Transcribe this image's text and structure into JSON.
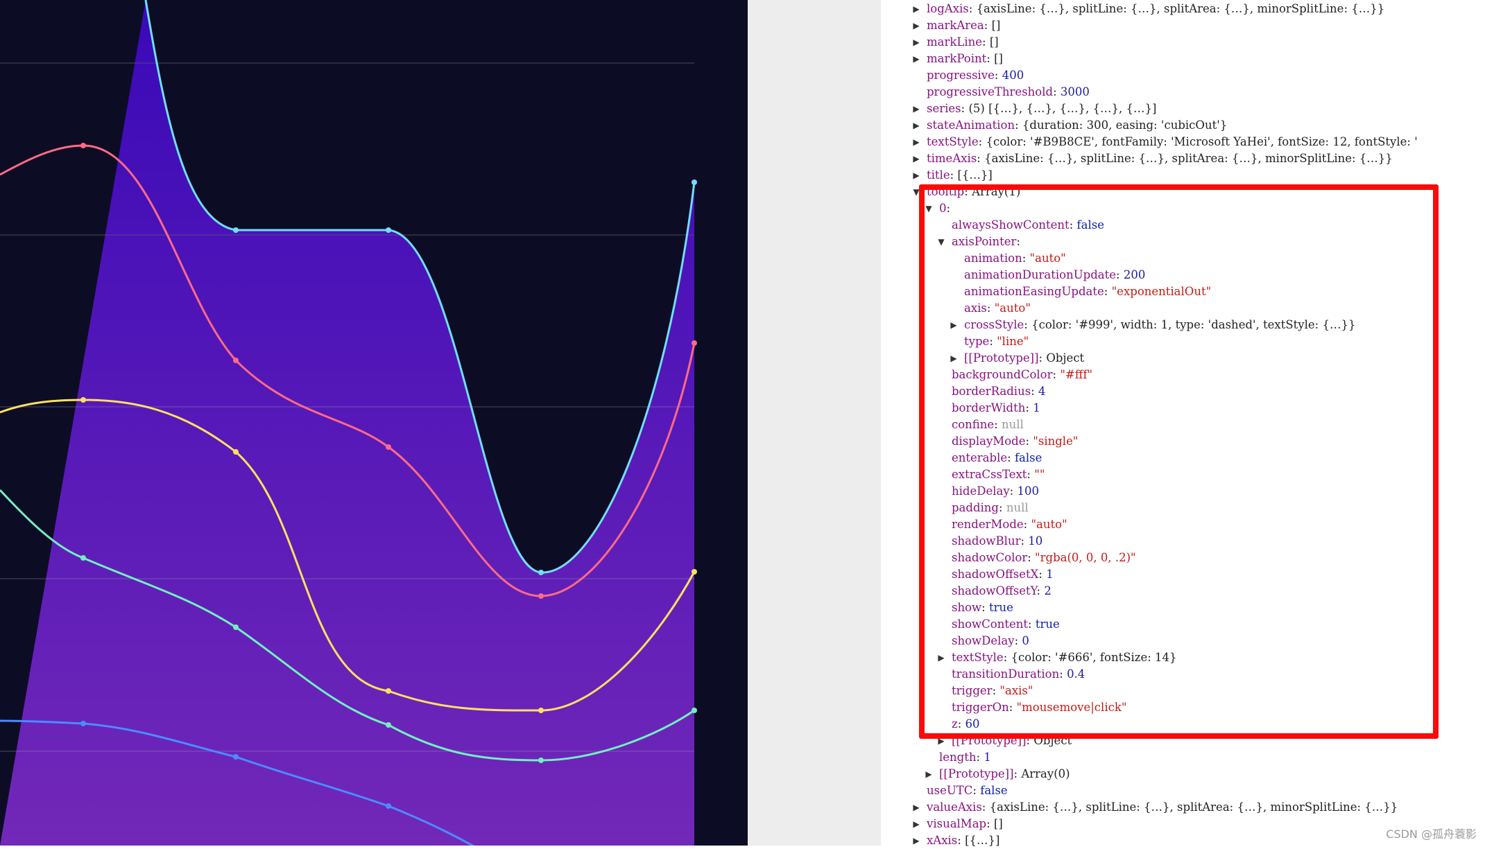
{
  "chart": {
    "background": "#0d0c25",
    "area_top": "#3a09b8",
    "area_bottom": "#7228b8",
    "series_colors": [
      "#6ee0ff",
      "#ff6b86",
      "#ffe15e",
      "#70f0c0",
      "#4a8cff"
    ]
  },
  "console": {
    "rows": [
      {
        "indent": 0,
        "tri": "right",
        "key": "logAxis",
        "value": "{axisLine: {…}, splitLine: {…}, splitArea: {…}, minorSplitLine: {…}}",
        "vtype": "obj"
      },
      {
        "indent": 0,
        "tri": "right",
        "key": "markArea",
        "value": "[]",
        "vtype": "obj"
      },
      {
        "indent": 0,
        "tri": "right",
        "key": "markLine",
        "value": "[]",
        "vtype": "obj"
      },
      {
        "indent": 0,
        "tri": "right",
        "key": "markPoint",
        "value": "[]",
        "vtype": "obj"
      },
      {
        "indent": 0,
        "tri": "",
        "key": "progressive",
        "value": "400",
        "vtype": "num"
      },
      {
        "indent": 0,
        "tri": "",
        "key": "progressiveThreshold",
        "value": "3000",
        "vtype": "num"
      },
      {
        "indent": 0,
        "tri": "right",
        "key": "series",
        "value": "(5)  [{…}, {…}, {…}, {…}, {…}]",
        "vtype": "obj"
      },
      {
        "indent": 0,
        "tri": "right",
        "key": "stateAnimation",
        "value": "{duration: 300, easing: 'cubicOut'}",
        "vtype": "obj"
      },
      {
        "indent": 0,
        "tri": "right",
        "key": "textStyle",
        "value": "{color: '#B9B8CE', fontFamily: 'Microsoft YaHei', fontSize: 12, fontStyle: '",
        "vtype": "obj"
      },
      {
        "indent": 0,
        "tri": "right",
        "key": "timeAxis",
        "value": "{axisLine: {…}, splitLine: {…}, splitArea: {…}, minorSplitLine: {…}}",
        "vtype": "obj"
      },
      {
        "indent": 0,
        "tri": "right",
        "key": "title",
        "value": "[{…}]",
        "vtype": "obj"
      },
      {
        "indent": 0,
        "tri": "down",
        "key": "tooltip",
        "value": "Array(1)",
        "vtype": "obj"
      },
      {
        "indent": 1,
        "tri": "down",
        "key": "0",
        "value": "",
        "vtype": "obj"
      },
      {
        "indent": 2,
        "tri": "",
        "key": "alwaysShowContent",
        "value": "false",
        "vtype": "kw"
      },
      {
        "indent": 2,
        "tri": "down",
        "key": "axisPointer",
        "value": "",
        "vtype": "obj"
      },
      {
        "indent": 3,
        "tri": "",
        "key": "animation",
        "value": "\"auto\"",
        "vtype": "str"
      },
      {
        "indent": 3,
        "tri": "",
        "key": "animationDurationUpdate",
        "value": "200",
        "vtype": "num"
      },
      {
        "indent": 3,
        "tri": "",
        "key": "animationEasingUpdate",
        "value": "\"exponentialOut\"",
        "vtype": "str"
      },
      {
        "indent": 3,
        "tri": "",
        "key": "axis",
        "value": "\"auto\"",
        "vtype": "str"
      },
      {
        "indent": 3,
        "tri": "right",
        "key": "crossStyle",
        "value": "{color: '#999', width: 1, type: 'dashed', textStyle: {…}}",
        "vtype": "obj"
      },
      {
        "indent": 3,
        "tri": "",
        "key": "type",
        "value": "\"line\"",
        "vtype": "str"
      },
      {
        "indent": 3,
        "tri": "right",
        "key": "[[Prototype]]",
        "value": "Object",
        "vtype": "obj"
      },
      {
        "indent": 2,
        "tri": "",
        "key": "backgroundColor",
        "value": "\"#fff\"",
        "vtype": "str"
      },
      {
        "indent": 2,
        "tri": "",
        "key": "borderRadius",
        "value": "4",
        "vtype": "num"
      },
      {
        "indent": 2,
        "tri": "",
        "key": "borderWidth",
        "value": "1",
        "vtype": "num"
      },
      {
        "indent": 2,
        "tri": "",
        "key": "confine",
        "value": "null",
        "vtype": "null"
      },
      {
        "indent": 2,
        "tri": "",
        "key": "displayMode",
        "value": "\"single\"",
        "vtype": "str"
      },
      {
        "indent": 2,
        "tri": "",
        "key": "enterable",
        "value": "false",
        "vtype": "kw"
      },
      {
        "indent": 2,
        "tri": "",
        "key": "extraCssText",
        "value": "\"\"",
        "vtype": "str"
      },
      {
        "indent": 2,
        "tri": "",
        "key": "hideDelay",
        "value": "100",
        "vtype": "num"
      },
      {
        "indent": 2,
        "tri": "",
        "key": "padding",
        "value": "null",
        "vtype": "null"
      },
      {
        "indent": 2,
        "tri": "",
        "key": "renderMode",
        "value": "\"auto\"",
        "vtype": "str"
      },
      {
        "indent": 2,
        "tri": "",
        "key": "shadowBlur",
        "value": "10",
        "vtype": "num"
      },
      {
        "indent": 2,
        "tri": "",
        "key": "shadowColor",
        "value": "\"rgba(0, 0, 0, .2)\"",
        "vtype": "str"
      },
      {
        "indent": 2,
        "tri": "",
        "key": "shadowOffsetX",
        "value": "1",
        "vtype": "num"
      },
      {
        "indent": 2,
        "tri": "",
        "key": "shadowOffsetY",
        "value": "2",
        "vtype": "num"
      },
      {
        "indent": 2,
        "tri": "",
        "key": "show",
        "value": "true",
        "vtype": "kw"
      },
      {
        "indent": 2,
        "tri": "",
        "key": "showContent",
        "value": "true",
        "vtype": "kw"
      },
      {
        "indent": 2,
        "tri": "",
        "key": "showDelay",
        "value": "0",
        "vtype": "num"
      },
      {
        "indent": 2,
        "tri": "right",
        "key": "textStyle",
        "value": "{color: '#666', fontSize: 14}",
        "vtype": "obj"
      },
      {
        "indent": 2,
        "tri": "",
        "key": "transitionDuration",
        "value": "0.4",
        "vtype": "num"
      },
      {
        "indent": 2,
        "tri": "",
        "key": "trigger",
        "value": "\"axis\"",
        "vtype": "str"
      },
      {
        "indent": 2,
        "tri": "",
        "key": "triggerOn",
        "value": "\"mousemove|click\"",
        "vtype": "str"
      },
      {
        "indent": 2,
        "tri": "",
        "key": "z",
        "value": "60",
        "vtype": "num"
      },
      {
        "indent": 2,
        "tri": "right",
        "key": "[[Prototype]]",
        "value": "Object",
        "vtype": "obj"
      },
      {
        "indent": 1,
        "tri": "",
        "key": "length",
        "value": "1",
        "vtype": "num"
      },
      {
        "indent": 1,
        "tri": "right",
        "key": "[[Prototype]]",
        "value": "Array(0)",
        "vtype": "obj"
      },
      {
        "indent": 0,
        "tri": "",
        "key": "useUTC",
        "value": "false",
        "vtype": "kw"
      },
      {
        "indent": 0,
        "tri": "right",
        "key": "valueAxis",
        "value": "{axisLine: {…}, splitLine: {…}, splitArea: {…}, minorSplitLine: {…}}",
        "vtype": "obj"
      },
      {
        "indent": 0,
        "tri": "right",
        "key": "visualMap",
        "value": "[]",
        "vtype": "obj"
      },
      {
        "indent": 0,
        "tri": "right",
        "key": "xAxis",
        "value": "[{…}]",
        "vtype": "obj"
      }
    ]
  },
  "watermark": "CSDN @孤舟蓑影"
}
